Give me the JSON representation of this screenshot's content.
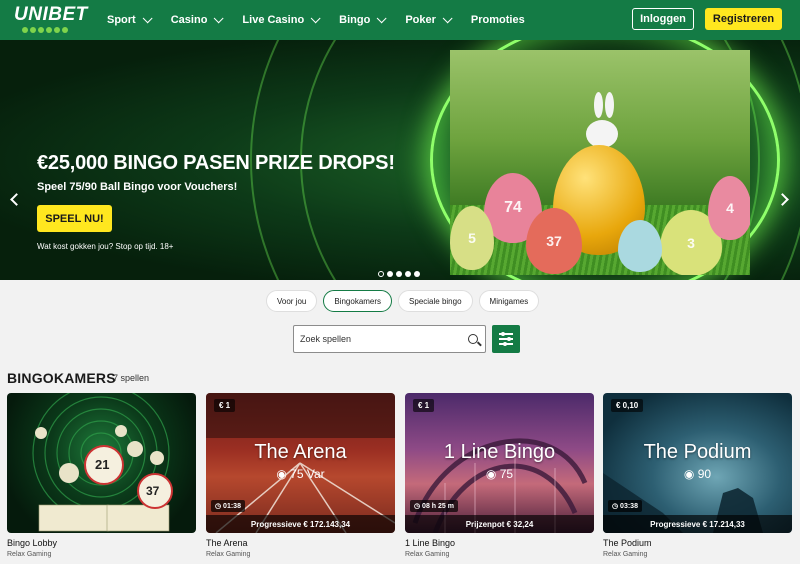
{
  "nav": {
    "logo": "UNIBET",
    "menu": [
      {
        "label": "Sport",
        "dropdown": true
      },
      {
        "label": "Casino",
        "dropdown": true
      },
      {
        "label": "Live Casino",
        "dropdown": true
      },
      {
        "label": "Bingo",
        "dropdown": true
      },
      {
        "label": "Poker",
        "dropdown": true
      },
      {
        "label": "Promoties",
        "dropdown": false
      }
    ],
    "login": "Inloggen",
    "register": "Registreren"
  },
  "hero": {
    "title": "€25,000 BINGO PASEN PRIZE DROPS!",
    "subtitle": "Speel 75/90 Ball Bingo voor Vouchers!",
    "cta": "SPEEL NU!",
    "note": "Wat kost gokken jou? Stop op tijd. 18+",
    "eggs": [
      "74",
      "37",
      "3",
      "4",
      "5"
    ],
    "slides": 5,
    "active_slide": 1
  },
  "tabs": [
    "Voor jou",
    "Bingokamers",
    "Speciale bingo",
    "Minigames"
  ],
  "active_tab": "Bingokamers",
  "search": {
    "placeholder": "Zoek spellen"
  },
  "section": {
    "title": "BINGOKAMERS",
    "count": "7 spellen"
  },
  "cards": [
    {
      "name": "Bingo Lobby",
      "provider": "Relax Gaming",
      "badge": "",
      "title": "",
      "ball": "",
      "timer": "",
      "bar": "",
      "balls": [
        "21",
        "37"
      ]
    },
    {
      "name": "The Arena",
      "provider": "Relax Gaming",
      "badge": "€ 1",
      "title": "The Arena",
      "ball": "◉ 75 Var",
      "timer": "◷ 01:38",
      "bar": "Progressieve € 172.143,34"
    },
    {
      "name": "1 Line Bingo",
      "provider": "Relax Gaming",
      "badge": "€ 1",
      "title": "1 Line Bingo",
      "ball": "◉ 75",
      "timer": "◷ 08 h 25 m",
      "bar": "Prijzenpot € 32,24"
    },
    {
      "name": "The Podium",
      "provider": "Relax Gaming",
      "badge": "€ 0,10",
      "title": "The Podium",
      "ball": "◉ 90",
      "timer": "◷ 03:38",
      "bar": "Progressieve € 17.214,33"
    }
  ],
  "colors": {
    "brand_green": "#147b45",
    "accent_yellow": "#ffe71f"
  }
}
